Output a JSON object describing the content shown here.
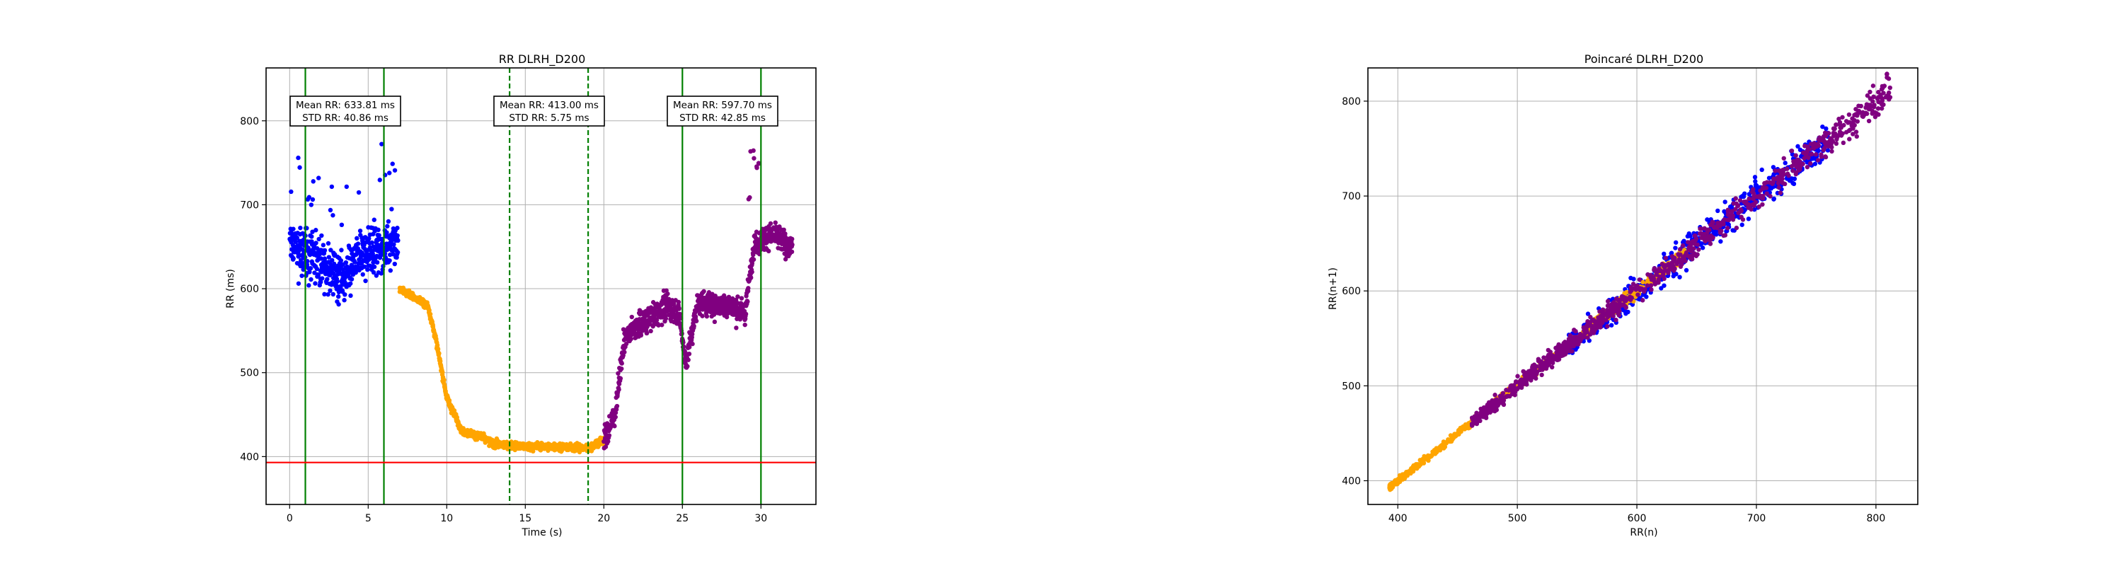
{
  "colors": {
    "blue": "#0000ff",
    "orange": "#ffa500",
    "purple": "#800080",
    "green": "#008000",
    "red": "#ff0000",
    "grid": "#b0b0b0"
  },
  "chart_data": [
    {
      "type": "scatter",
      "title": "RR DLRH_D200",
      "xlabel": "Time (s)",
      "ylabel": "RR (ms)",
      "xlim": [
        -1.5,
        33.5
      ],
      "ylim": [
        343,
        863
      ],
      "xticks": [
        0,
        5,
        10,
        15,
        20,
        25,
        30
      ],
      "yticks": [
        400,
        500,
        600,
        700,
        800
      ],
      "grid": true,
      "segments": [
        {
          "color": "blue",
          "x_start": 0.0,
          "x_end": 6.9,
          "profile": [
            [
              0.0,
              650
            ],
            [
              1.5,
              640
            ],
            [
              2.5,
              620
            ],
            [
              3.5,
              610
            ],
            [
              4.5,
              640
            ],
            [
              6.0,
              650
            ],
            [
              6.9,
              660
            ]
          ],
          "spread": 40
        },
        {
          "color": "orange",
          "x_start": 7.0,
          "x_end": 20.0,
          "profile": [
            [
              7.0,
              600
            ],
            [
              8.8,
              580
            ],
            [
              9.3,
              540
            ],
            [
              10.0,
              470
            ],
            [
              11.0,
              430
            ],
            [
              12.0,
              425
            ],
            [
              13.0,
              415
            ],
            [
              15.0,
              412
            ],
            [
              17.0,
              412
            ],
            [
              19.0,
              410
            ],
            [
              20.0,
              420
            ]
          ],
          "spread": 6
        },
        {
          "color": "purple",
          "x_start": 20.0,
          "x_end": 32.0,
          "profile": [
            [
              20.0,
              420
            ],
            [
              20.7,
              450
            ],
            [
              21.3,
              540
            ],
            [
              22.0,
              555
            ],
            [
              23.0,
              565
            ],
            [
              24.0,
              580
            ],
            [
              24.8,
              570
            ],
            [
              25.2,
              510
            ],
            [
              26.0,
              585
            ],
            [
              27.0,
              580
            ],
            [
              28.0,
              580
            ],
            [
              29.0,
              570
            ],
            [
              29.5,
              650
            ],
            [
              30.5,
              665
            ],
            [
              32.0,
              650
            ]
          ],
          "spread": 20
        }
      ],
      "vlines": [
        {
          "x": 1,
          "style": "solid",
          "color": "green"
        },
        {
          "x": 6,
          "style": "solid",
          "color": "green"
        },
        {
          "x": 14,
          "style": "dashed",
          "color": "green"
        },
        {
          "x": 19,
          "style": "dashed",
          "color": "green"
        },
        {
          "x": 25,
          "style": "solid",
          "color": "green"
        },
        {
          "x": 30,
          "style": "solid",
          "color": "green"
        }
      ],
      "hline": {
        "y": 393,
        "color": "red"
      },
      "annotations": [
        {
          "x": 3.5,
          "y": 808,
          "line1": "Mean RR: 633.81 ms",
          "line2": "STD RR: 40.86 ms"
        },
        {
          "x": 16.5,
          "y": 808,
          "line1": "Mean RR: 413.00 ms",
          "line2": "STD RR: 5.75 ms"
        },
        {
          "x": 27.5,
          "y": 808,
          "line1": "Mean RR: 597.70 ms",
          "line2": "STD RR: 42.85 ms"
        }
      ]
    },
    {
      "type": "scatter",
      "title": "Poincaré DLRH_D200",
      "xlabel": "RR(n)",
      "ylabel": "RR(n+1)",
      "xlim": [
        375,
        835
      ],
      "ylim": [
        375,
        835
      ],
      "xticks": [
        400,
        500,
        600,
        700,
        800
      ],
      "yticks": [
        400,
        500,
        600,
        700,
        800
      ],
      "grid": true,
      "series": [
        {
          "color": "blue",
          "x_range": [
            540,
            760
          ],
          "spread": 14
        },
        {
          "color": "orange",
          "x_range": [
            393,
            640
          ],
          "spread": 6
        },
        {
          "color": "purple",
          "x_range": [
            400,
            812
          ],
          "spread": 10
        }
      ]
    }
  ]
}
